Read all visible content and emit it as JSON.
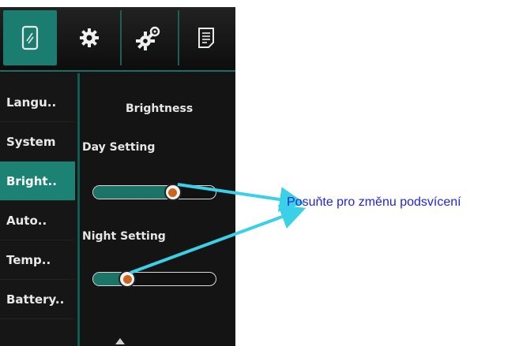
{
  "tabs": [
    {
      "icon": "phone-icon",
      "active": true
    },
    {
      "icon": "gear-icon",
      "active": false
    },
    {
      "icon": "gears-icon",
      "active": false
    },
    {
      "icon": "document-icon",
      "active": false
    }
  ],
  "sidebar": {
    "items": [
      {
        "label": "Langu..",
        "active": false
      },
      {
        "label": "System",
        "active": false
      },
      {
        "label": "Bright..",
        "active": true
      },
      {
        "label": "Auto..",
        "active": false
      },
      {
        "label": "Temp..",
        "active": false
      },
      {
        "label": "Battery..",
        "active": false
      }
    ]
  },
  "content": {
    "title": "Brightness",
    "day": {
      "label": "Day Setting",
      "value": 0.65
    },
    "night": {
      "label": "Night Setting",
      "value": 0.28
    }
  },
  "annotation": {
    "text": "Posuňte pro změnu podsvícení",
    "color": "#2424d8"
  },
  "colors": {
    "accent": "#1c8274",
    "arrow": "#3ad0e8",
    "knob_center": "#c8651e"
  }
}
